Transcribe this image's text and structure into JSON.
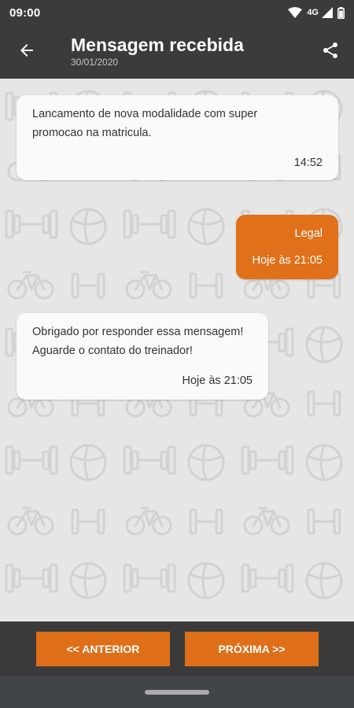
{
  "status_bar": {
    "time": "09:00",
    "network": "4G",
    "icons": [
      "wifi-icon",
      "signal-icon",
      "battery-icon"
    ]
  },
  "app_bar": {
    "title": "Mensagem recebida",
    "date": "30/01/2020",
    "back_icon": "arrow-back-icon",
    "share_icon": "share-icon"
  },
  "messages": [
    {
      "direction": "incoming",
      "lines": [
        "Lancamento de nova modalidade com super",
        "promocao na matricula."
      ],
      "time": "14:52"
    },
    {
      "direction": "outgoing",
      "lines": [
        "Legal"
      ],
      "time": "Hoje às 21:05"
    },
    {
      "direction": "incoming",
      "lines": [
        "Obrigado por responder essa mensagem!",
        "Aguarde o contato do treinador!"
      ],
      "time": "Hoje às 21:05"
    }
  ],
  "navigation": {
    "previous_label": "<< ANTERIOR",
    "next_label": "PRÓXIMA >>"
  },
  "colors": {
    "accent": "#E07019",
    "toolbar": "#3B3B3B",
    "chat_background": "#E6E6E6",
    "bubble_in": "#FAFAFA"
  }
}
